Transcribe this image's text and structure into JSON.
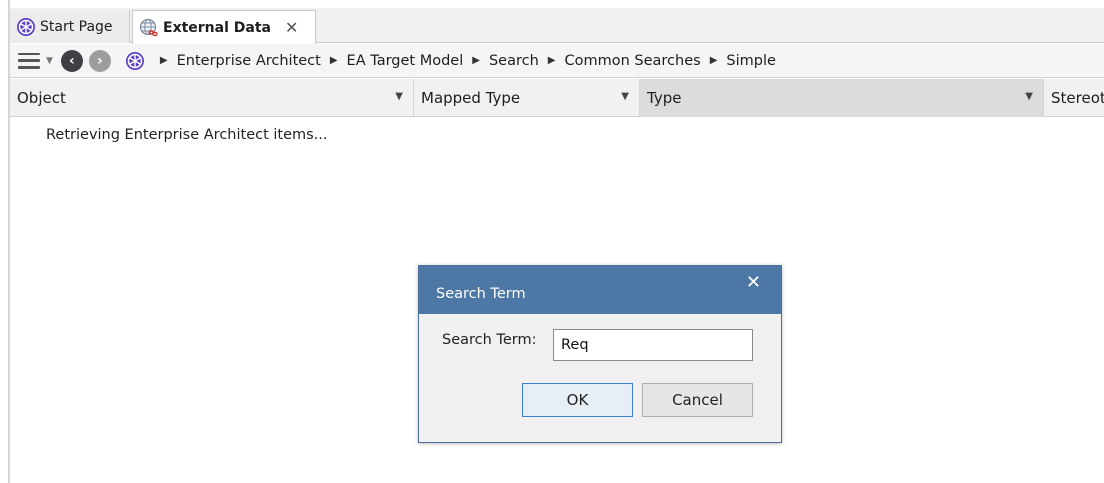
{
  "tabs": [
    {
      "label": "Start Page",
      "icon": "ea-logo-icon"
    },
    {
      "label": "External Data",
      "icon": "globe-link-icon",
      "close": "✕"
    }
  ],
  "toolbar": {
    "breadcrumb": [
      "Enterprise Architect",
      "EA Target Model",
      "Search",
      "Common Searches",
      "Simple"
    ]
  },
  "columns": {
    "object": "Object",
    "mapped_type": "Mapped Type",
    "type": "Type",
    "stereotype": "Stereot"
  },
  "status_text": "Retrieving Enterprise Architect items...",
  "dialog": {
    "title": "Search Term",
    "close": "✕",
    "label": "Search Term:",
    "value": "Req",
    "ok": "OK",
    "cancel": "Cancel"
  },
  "colors": {
    "dialog_title_bg": "#4d77a5",
    "ea_logo": "#5b3fc9"
  }
}
